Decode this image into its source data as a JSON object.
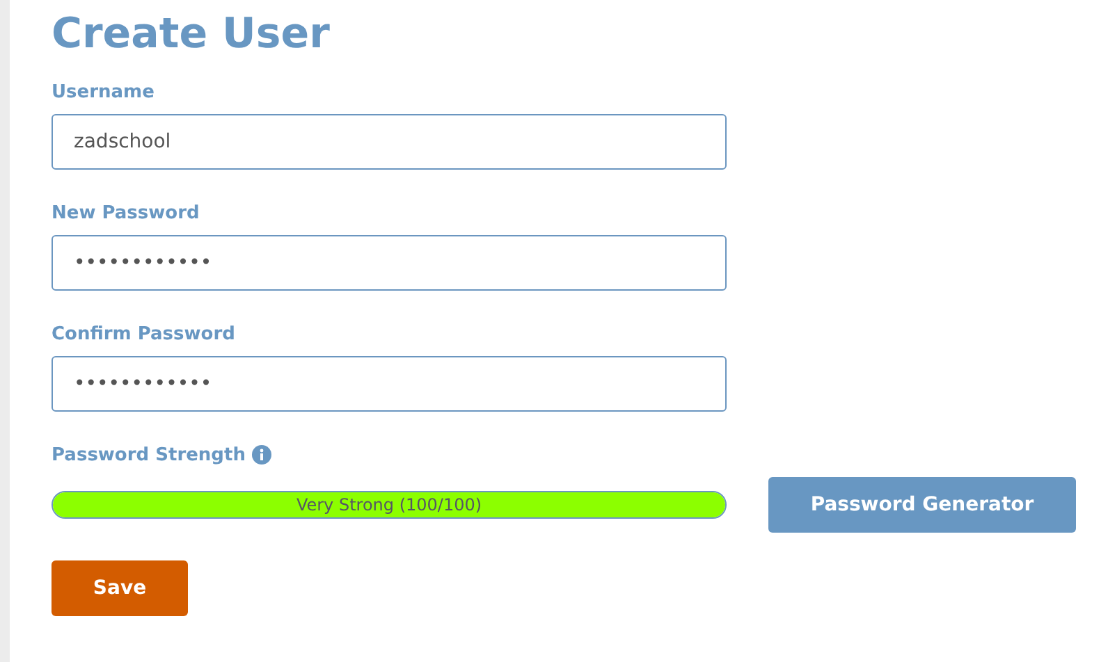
{
  "title": "Create User",
  "fields": [
    {
      "label": "Username",
      "value": "zadschool"
    },
    {
      "label": "New Password",
      "value": "••••••••••••"
    },
    {
      "label": "Confirm Password",
      "value": "••••••••••••"
    }
  ],
  "strength": {
    "label": "Password Strength",
    "level": 1,
    "reading": "Very Strong (100/100)"
  },
  "generator_button": "Password Generator",
  "save_button": "Save"
}
